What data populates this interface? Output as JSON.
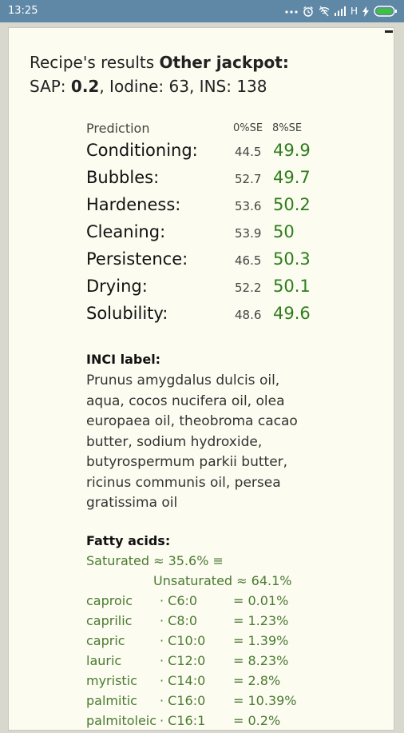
{
  "status_bar": {
    "time": "13:25",
    "network": "H",
    "icons": [
      "more-dots-icon",
      "alarm-icon",
      "wifi-off-icon",
      "signal-icon",
      "charging-icon",
      "battery-icon"
    ]
  },
  "results": {
    "title_prefix": "Recipe's results",
    "title_name": "Other jackpot:",
    "sap_label": "SAP:",
    "sap_value": "0.2",
    "iodine": ", Iodine: 63, INS: 138"
  },
  "prediction": {
    "header": "Prediction",
    "col0": "0%SE",
    "col8": "8%SE",
    "rows": [
      {
        "name": "Conditioning:",
        "v0": "44.5",
        "v8": "49.9"
      },
      {
        "name": "Bubbles:",
        "v0": "52.7",
        "v8": "49.7"
      },
      {
        "name": "Hardeness:",
        "v0": "53.6",
        "v8": "50.2"
      },
      {
        "name": "Cleaning:",
        "v0": "53.9",
        "v8": "50"
      },
      {
        "name": "Persistence:",
        "v0": "46.5",
        "v8": "50.3"
      },
      {
        "name": "Drying:",
        "v0": "52.2",
        "v8": "50.1"
      },
      {
        "name": "Solubility:",
        "v0": "48.6",
        "v8": "49.6"
      }
    ]
  },
  "inci": {
    "header": "INCI label:",
    "lines": [
      "Prunus amygdalus dulcis oil,",
      "aqua, cocos nucifera oil, olea",
      "europaea oil, theobroma cacao",
      "butter, sodium hydroxide,",
      "butyrospermum parkii butter,",
      "ricinus communis oil, persea",
      "gratissima oil"
    ]
  },
  "fatty_acids": {
    "header": "Fatty acids:",
    "saturated": "Saturated ≈ 35.6% ≡",
    "unsaturated": "Unsaturated ≈ 64.1%",
    "rows": [
      {
        "name": "caproic",
        "code": "· C6:0",
        "pct": "= 0.01%"
      },
      {
        "name": "caprilic",
        "code": "· C8:0",
        "pct": "= 1.23%"
      },
      {
        "name": "capric",
        "code": "· C10:0",
        "pct": "= 1.39%"
      },
      {
        "name": "lauric",
        "code": "· C12:0",
        "pct": "= 8.23%"
      },
      {
        "name": "myristic",
        "code": "· C14:0",
        "pct": "= 2.8%"
      },
      {
        "name": "palmitic",
        "code": "· C16:0",
        "pct": "= 10.39%"
      },
      {
        "name": "palmitoleic",
        "code": "· C16:1",
        "pct": "= 0.2%"
      }
    ]
  },
  "colors": {
    "status_bar": "#5f88a6",
    "card_background": "#fcfcf1",
    "accent_green": "#2e7d1a",
    "fatty_green": "#4a7a30"
  }
}
